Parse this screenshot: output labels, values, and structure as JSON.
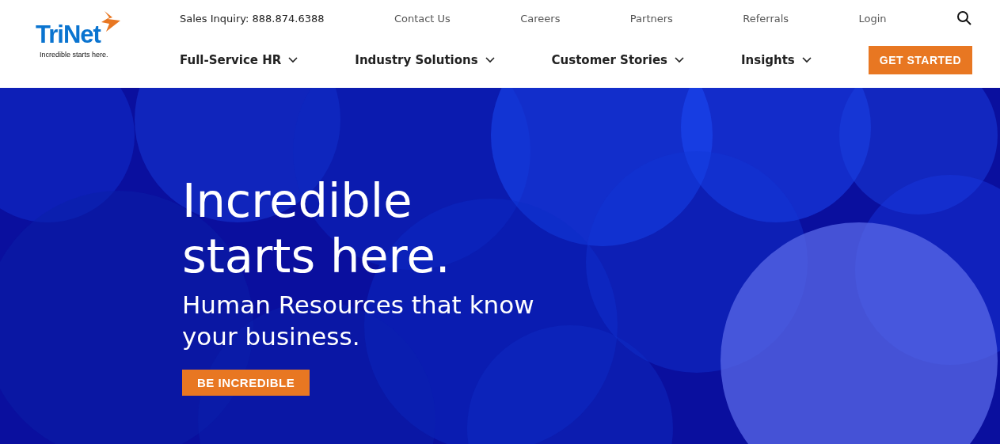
{
  "logo": {
    "name": "TriNet",
    "tagline": "Incredible starts here."
  },
  "utility_bar": {
    "sales": "Sales Inquiry: 888.874.6388",
    "links": [
      {
        "label": "Contact Us"
      },
      {
        "label": "Careers"
      },
      {
        "label": "Partners"
      },
      {
        "label": "Referrals"
      },
      {
        "label": "Login"
      }
    ]
  },
  "nav": {
    "items": [
      {
        "label": "Full-Service HR"
      },
      {
        "label": "Industry Solutions"
      },
      {
        "label": "Customer Stories"
      },
      {
        "label": "Insights"
      }
    ],
    "cta": "GET STARTED"
  },
  "hero": {
    "title": "Incredible starts here.",
    "subtitle": "Human Resources that know your business.",
    "button": "BE INCREDIBLE"
  }
}
